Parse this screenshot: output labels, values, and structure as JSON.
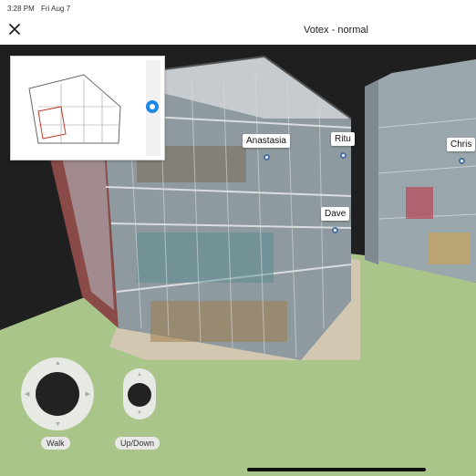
{
  "status": {
    "time": "3:28 PM",
    "date": "Fri Aug 7"
  },
  "header": {
    "title": "Votex - normal",
    "close_icon": "close-icon"
  },
  "people": [
    {
      "name": "Anastasia"
    },
    {
      "name": "Ritu"
    },
    {
      "name": "Dave"
    },
    {
      "name": "Chris"
    }
  ],
  "controls": {
    "walk_label": "Walk",
    "updown_label": "Up/Down"
  },
  "colors": {
    "sky": "#1f1f1f",
    "grass": "#a9c58a",
    "accent": "#1e88e5",
    "pin": "#4a6fa5"
  }
}
